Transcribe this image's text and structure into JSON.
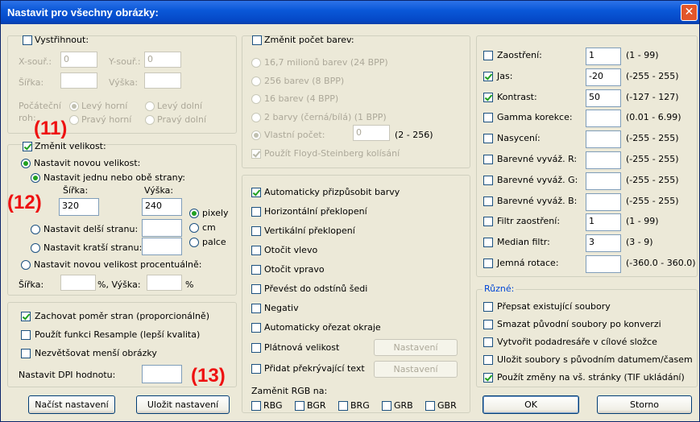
{
  "window": {
    "title": "Nastavit pro všechny obrázky:",
    "close_glyph": "✕"
  },
  "crop": {
    "label": "Vystřihnout:",
    "x_label": "X-souř.:",
    "x_value": "0",
    "y_label": "Y-souř.:",
    "y_value": "0",
    "width_label": "Šířka:",
    "height_label": "Výška:",
    "corner_label_1": "Počáteční",
    "corner_label_2": "roh:",
    "corners": [
      "Levý horní",
      "Levý dolní",
      "Pravý horní",
      "Pravý dolní"
    ]
  },
  "resize": {
    "label": "Změnit velikost:",
    "new_size": "Nastavit novou velikost:",
    "one_or_both": "Nastavit jednu nebo obě strany:",
    "width_col": "Šířka:",
    "height_col": "Výška:",
    "width_value": "320",
    "height_value": "240",
    "longer": "Nastavit delší stranu:",
    "shorter": "Nastavit kratší stranu:",
    "units": [
      "pixely",
      "cm",
      "palce"
    ],
    "percent": "Nastavit novou velikost procentuálně:",
    "pct_width": "Šířka:",
    "pct_mid": "%, Výška:",
    "pct_end": "%"
  },
  "options_left": {
    "keep_ratio": "Zachovat poměr stran (proporcionálně)",
    "resample": "Použít funkci Resample (lepší kvalita)",
    "no_enlarge": "Nezvětšovat menší obrázky",
    "dpi_label": "Nastavit DPI hodnotu:"
  },
  "buttons": {
    "load": "Načíst nastavení",
    "save": "Uložit nastavení",
    "ok": "OK",
    "cancel": "Storno",
    "settings": "Nastavení"
  },
  "annotations": {
    "a11": "(11)",
    "a12": "(12)",
    "a13": "(13)"
  },
  "colors_section": {
    "label": "Změnit počet barev:",
    "options": [
      "16,7 milionů barev (24 BPP)",
      "256 barev (8 BPP)",
      "16 barev (4 BPP)",
      "2 barvy (černá/bílá) (1 BPP)"
    ],
    "custom": "Vlastní počet:",
    "custom_value": "0",
    "custom_range": "(2 - 256)",
    "floyd": "Použít Floyd-Steinberg kolísání"
  },
  "middle_options": {
    "items": [
      "Automaticky přizpůsobit barvy",
      "Horizontální překlopení",
      "Vertikální překlopení",
      "Otočit vlevo",
      "Otočit vpravo",
      "Převést do odstínů šedi",
      "Negativ",
      "Automaticky ořezat okraje",
      "Plátnová velikost",
      "Přidat překrývající text"
    ],
    "swap_label": "Zaměnit RGB na:",
    "swaps": [
      "RBG",
      "BGR",
      "BRG",
      "GRB",
      "GBR"
    ]
  },
  "adjust": {
    "rows": [
      {
        "label": "Zaostření:",
        "value": "1",
        "range": "(1 - 99)"
      },
      {
        "label": "Jas:",
        "value": "-20",
        "range": "(-255 - 255)"
      },
      {
        "label": "Kontrast:",
        "value": "50",
        "range": "(-127 - 127)"
      },
      {
        "label": "Gamma korekce:",
        "value": "",
        "range": "(0.01 - 6.99)"
      },
      {
        "label": "Nasycení:",
        "value": "",
        "range": "(-255 - 255)"
      },
      {
        "label": "Barevné vyváž. R:",
        "value": "",
        "range": "(-255 - 255)"
      },
      {
        "label": "Barevné vyváž. G:",
        "value": "",
        "range": "(-255 - 255)"
      },
      {
        "label": "Barevné vyváž. B:",
        "value": "",
        "range": "(-255 - 255)"
      },
      {
        "label": "Filtr zaostření:",
        "value": "1",
        "range": "(1 - 99)"
      },
      {
        "label": "Median filtr:",
        "value": "3",
        "range": "(3 - 9)"
      },
      {
        "label": "Jemná rotace:",
        "value": "",
        "range": "(-360.0 - 360.0)"
      }
    ]
  },
  "misc": {
    "label": "Různé:",
    "items": [
      "Přepsat existující soubory",
      "Smazat původní soubory po konverzi",
      "Vytvořit podadresáře v cílové složce",
      "Uložit soubory s původním datumem/časem",
      "Použít změny na vš. stránky (TIF ukládání)"
    ]
  }
}
